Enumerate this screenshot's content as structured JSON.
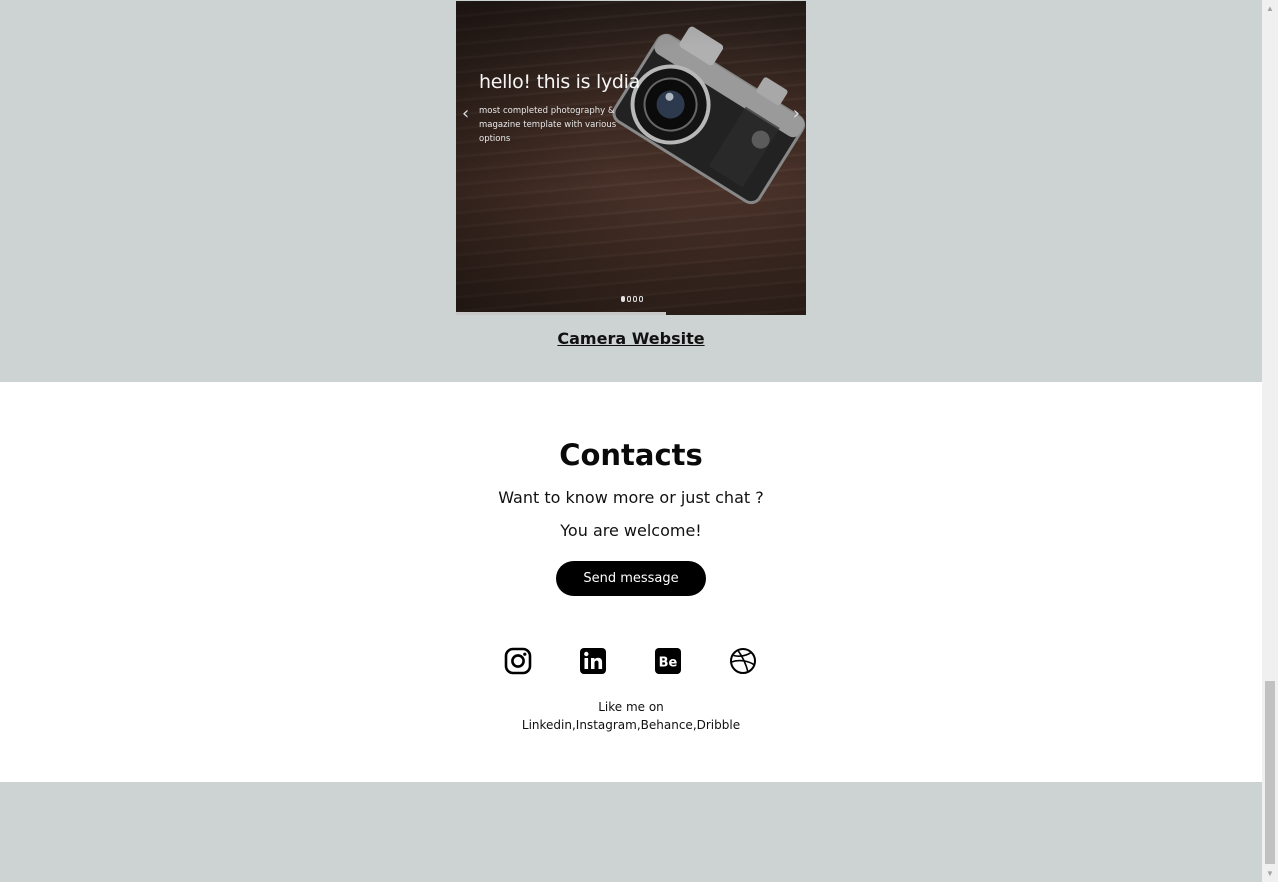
{
  "portfolio": {
    "slide": {
      "title": "hello! this is lydia",
      "subtitle": "most completed photography & magazine template with various options",
      "prev_arrow": "‹",
      "next_arrow": "›",
      "dots_count": 4,
      "active_dot": 1
    },
    "project_link": "Camera Website"
  },
  "contacts": {
    "title": "Contacts",
    "line1": "Want to know more or just chat ?",
    "line2": "You are welcome!",
    "button_label": "Send message",
    "social_icons": [
      "instagram-icon",
      "linkedin-icon",
      "behance-icon",
      "dribbble-icon"
    ],
    "behance_text": "Be",
    "caption_line1": "Like me on",
    "caption_line2": "Linkedin,Instagram,Behance,Dribble"
  },
  "scrollbar": {
    "up_arrow": "▲",
    "down_arrow": "▼"
  },
  "colors": {
    "section_gray": "#cdd2d2",
    "button_black": "#000000",
    "button_text": "#ffffff"
  }
}
